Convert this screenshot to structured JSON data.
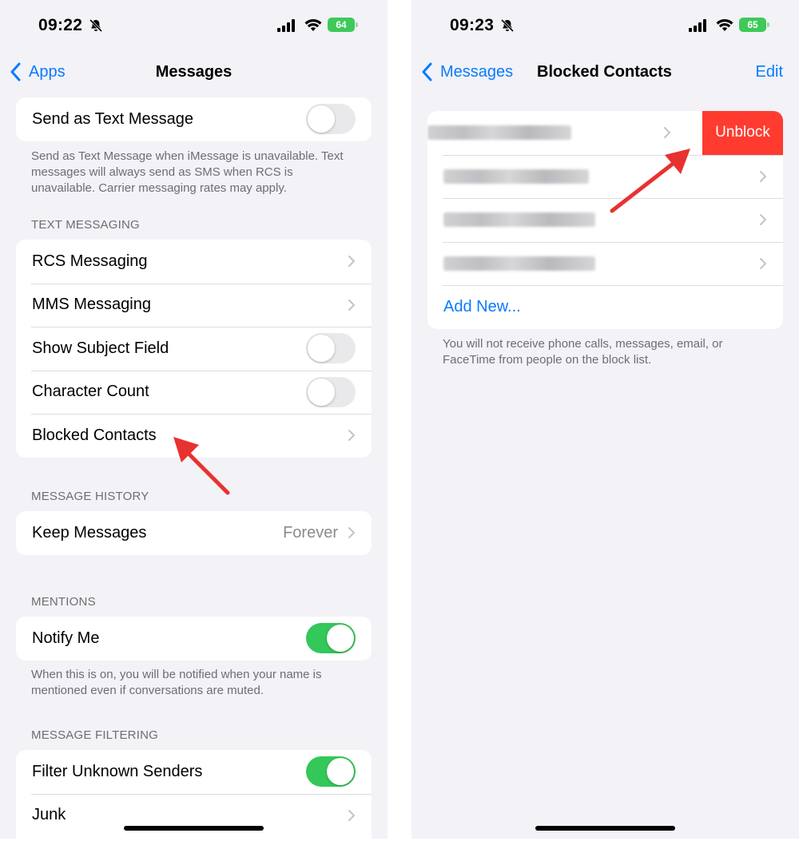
{
  "left_screen": {
    "status": {
      "time": "09:22",
      "battery": "64"
    },
    "nav": {
      "back_label": "Apps",
      "title": "Messages"
    },
    "send_as_text": {
      "label": "Send as Text Message",
      "toggle": "off",
      "footer": "Send as Text Message when iMessage is unavailable. Text messages will always send as SMS when RCS is unavailable. Carrier messaging rates may apply."
    },
    "text_messaging": {
      "header": "TEXT MESSAGING",
      "items": [
        {
          "label": "RCS Messaging",
          "accessory": "chevron"
        },
        {
          "label": "MMS Messaging",
          "accessory": "chevron"
        },
        {
          "label": "Show Subject Field",
          "accessory": "toggle-off"
        },
        {
          "label": "Character Count",
          "accessory": "toggle-off"
        },
        {
          "label": "Blocked Contacts",
          "accessory": "chevron"
        }
      ]
    },
    "message_history": {
      "header": "MESSAGE HISTORY",
      "keep_messages_label": "Keep Messages",
      "keep_messages_value": "Forever"
    },
    "mentions": {
      "header": "MENTIONS",
      "notify_label": "Notify Me",
      "toggle": "on",
      "footer": "When this is on, you will be notified when your name is mentioned even if conversations are muted."
    },
    "message_filtering": {
      "header": "MESSAGE FILTERING",
      "filter_label": "Filter Unknown Senders",
      "toggle": "on",
      "junk_label": "Junk"
    }
  },
  "right_screen": {
    "status": {
      "time": "09:23",
      "battery": "65"
    },
    "nav": {
      "back_label": "Messages",
      "title": "Blocked Contacts",
      "action_label": "Edit"
    },
    "blocked_rows": 4,
    "unblock_label": "Unblock",
    "add_new_label": "Add New...",
    "footer": "You will not receive phone calls, messages, email, or FaceTime from people on the block list."
  },
  "colors": {
    "accent": "#0a7aff",
    "toggle_on": "#34c759",
    "destructive": "#ff3b30",
    "annotation_arrow": "#e8322f",
    "background": "#f2f2f7"
  },
  "icons": [
    "bell-slash-icon",
    "cellular-signal-icon",
    "wifi-icon",
    "battery-icon",
    "chevron-left-icon",
    "chevron-right-icon",
    "annotation-arrow"
  ]
}
